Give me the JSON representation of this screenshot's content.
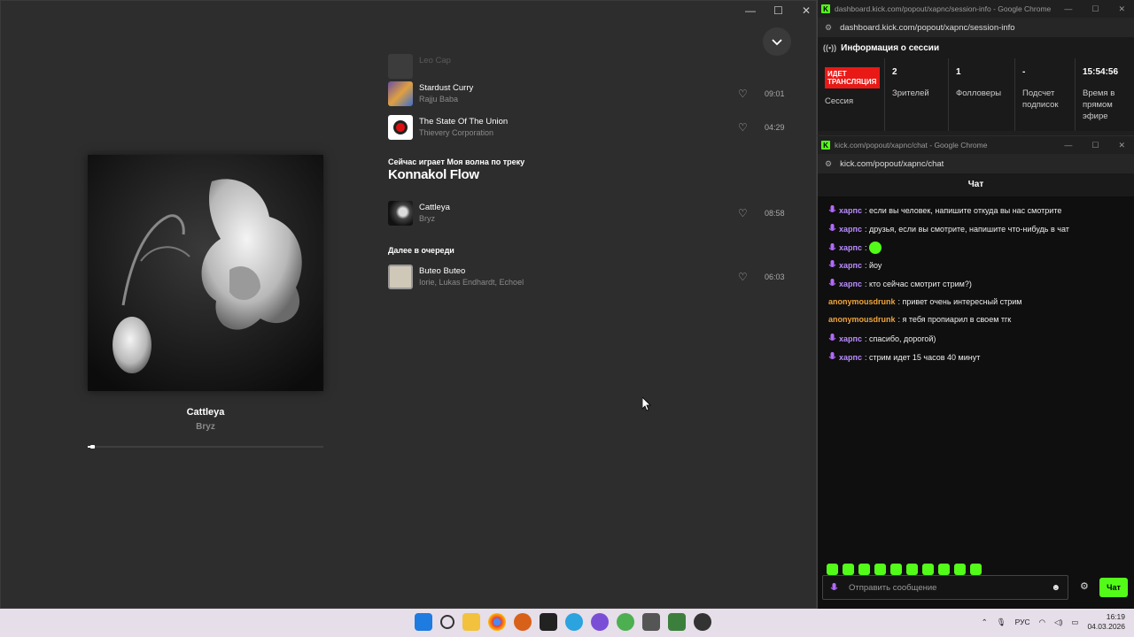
{
  "player": {
    "tracks_above": [
      {
        "title": "Leo Cap",
        "artist": "",
        "duration": "",
        "faded": true
      },
      {
        "title": "Stardust Curry",
        "artist": "Rajju Baba",
        "duration": "09:01"
      },
      {
        "title": "The State Of The Union",
        "artist": "Thievery Corporation",
        "duration": "04:29"
      }
    ],
    "wave_label": "Сейчас играет Моя волна по треку",
    "wave_title": "Konnakol Flow",
    "current_track": {
      "title": "Cattleya",
      "artist": "Bryz",
      "duration": "08:58"
    },
    "queue_label": "Далее в очереди",
    "queue": [
      {
        "title": "Buteo Buteo",
        "artist": "Iorie, Lukas Endhardt, Echoel",
        "duration": "06:03"
      }
    ],
    "now_playing": {
      "title": "Cattleya",
      "artist": "Bryz",
      "progress": 0.02
    }
  },
  "session_window": {
    "title": "dashboard.kick.com/popout/xapnc/session-info - Google Chrome",
    "url": "dashboard.kick.com/popout/xapnc/session-info",
    "header": "Информация о сессии",
    "live_badge": "ИДЕТ ТРАНСЛЯЦИЯ",
    "session_label": "Сессия",
    "stats": [
      {
        "value": "2",
        "label": "Зрителей"
      },
      {
        "value": "1",
        "label": "Фолловеры"
      },
      {
        "value": "-",
        "label": "Подсчет подписок"
      },
      {
        "value": "15:54:56",
        "label": "Время в прямом эфире"
      }
    ]
  },
  "chat_window": {
    "title": "kick.com/popout/xapnc/chat - Google Chrome",
    "url": "kick.com/popout/xapnc/chat",
    "header": "Чат",
    "messages": [
      {
        "user": "харпс",
        "text": ": если вы человек, напишите откуда вы нас смотрите",
        "badge": true
      },
      {
        "user": "харпс",
        "text": ": друзья, если вы смотрите, напишите что-нибудь в чат",
        "badge": true
      },
      {
        "user": "харпс",
        "text": ":",
        "badge": true,
        "emote": true
      },
      {
        "user": "харпс",
        "text": ": йоу",
        "badge": true
      },
      {
        "user": "харпс",
        "text": ": кто сейчас смотрит стрим?)",
        "badge": true
      },
      {
        "user": "anonymousdrunk",
        "text": ": привет очень интересный стрим",
        "badge": false
      },
      {
        "user": "anonymousdrunk",
        "text": ": я тебя пропиарил в своем тгк",
        "badge": false
      },
      {
        "user": "харпс",
        "text": ": спасибо, дорогой)",
        "badge": true
      },
      {
        "user": "харпс",
        "text": ": стрим идет 15 часов 40 минут",
        "badge": true
      }
    ],
    "input_placeholder": "Отправить сообщение",
    "send_label": "Чат"
  },
  "taskbar": {
    "language": "РУС",
    "time": "16:19",
    "date": "04.03.2026"
  },
  "colors": {
    "kick_green": "#53fc18",
    "live_red": "#e91916",
    "user_purple": "#b98dff",
    "user_orange": "#f0a53a"
  }
}
